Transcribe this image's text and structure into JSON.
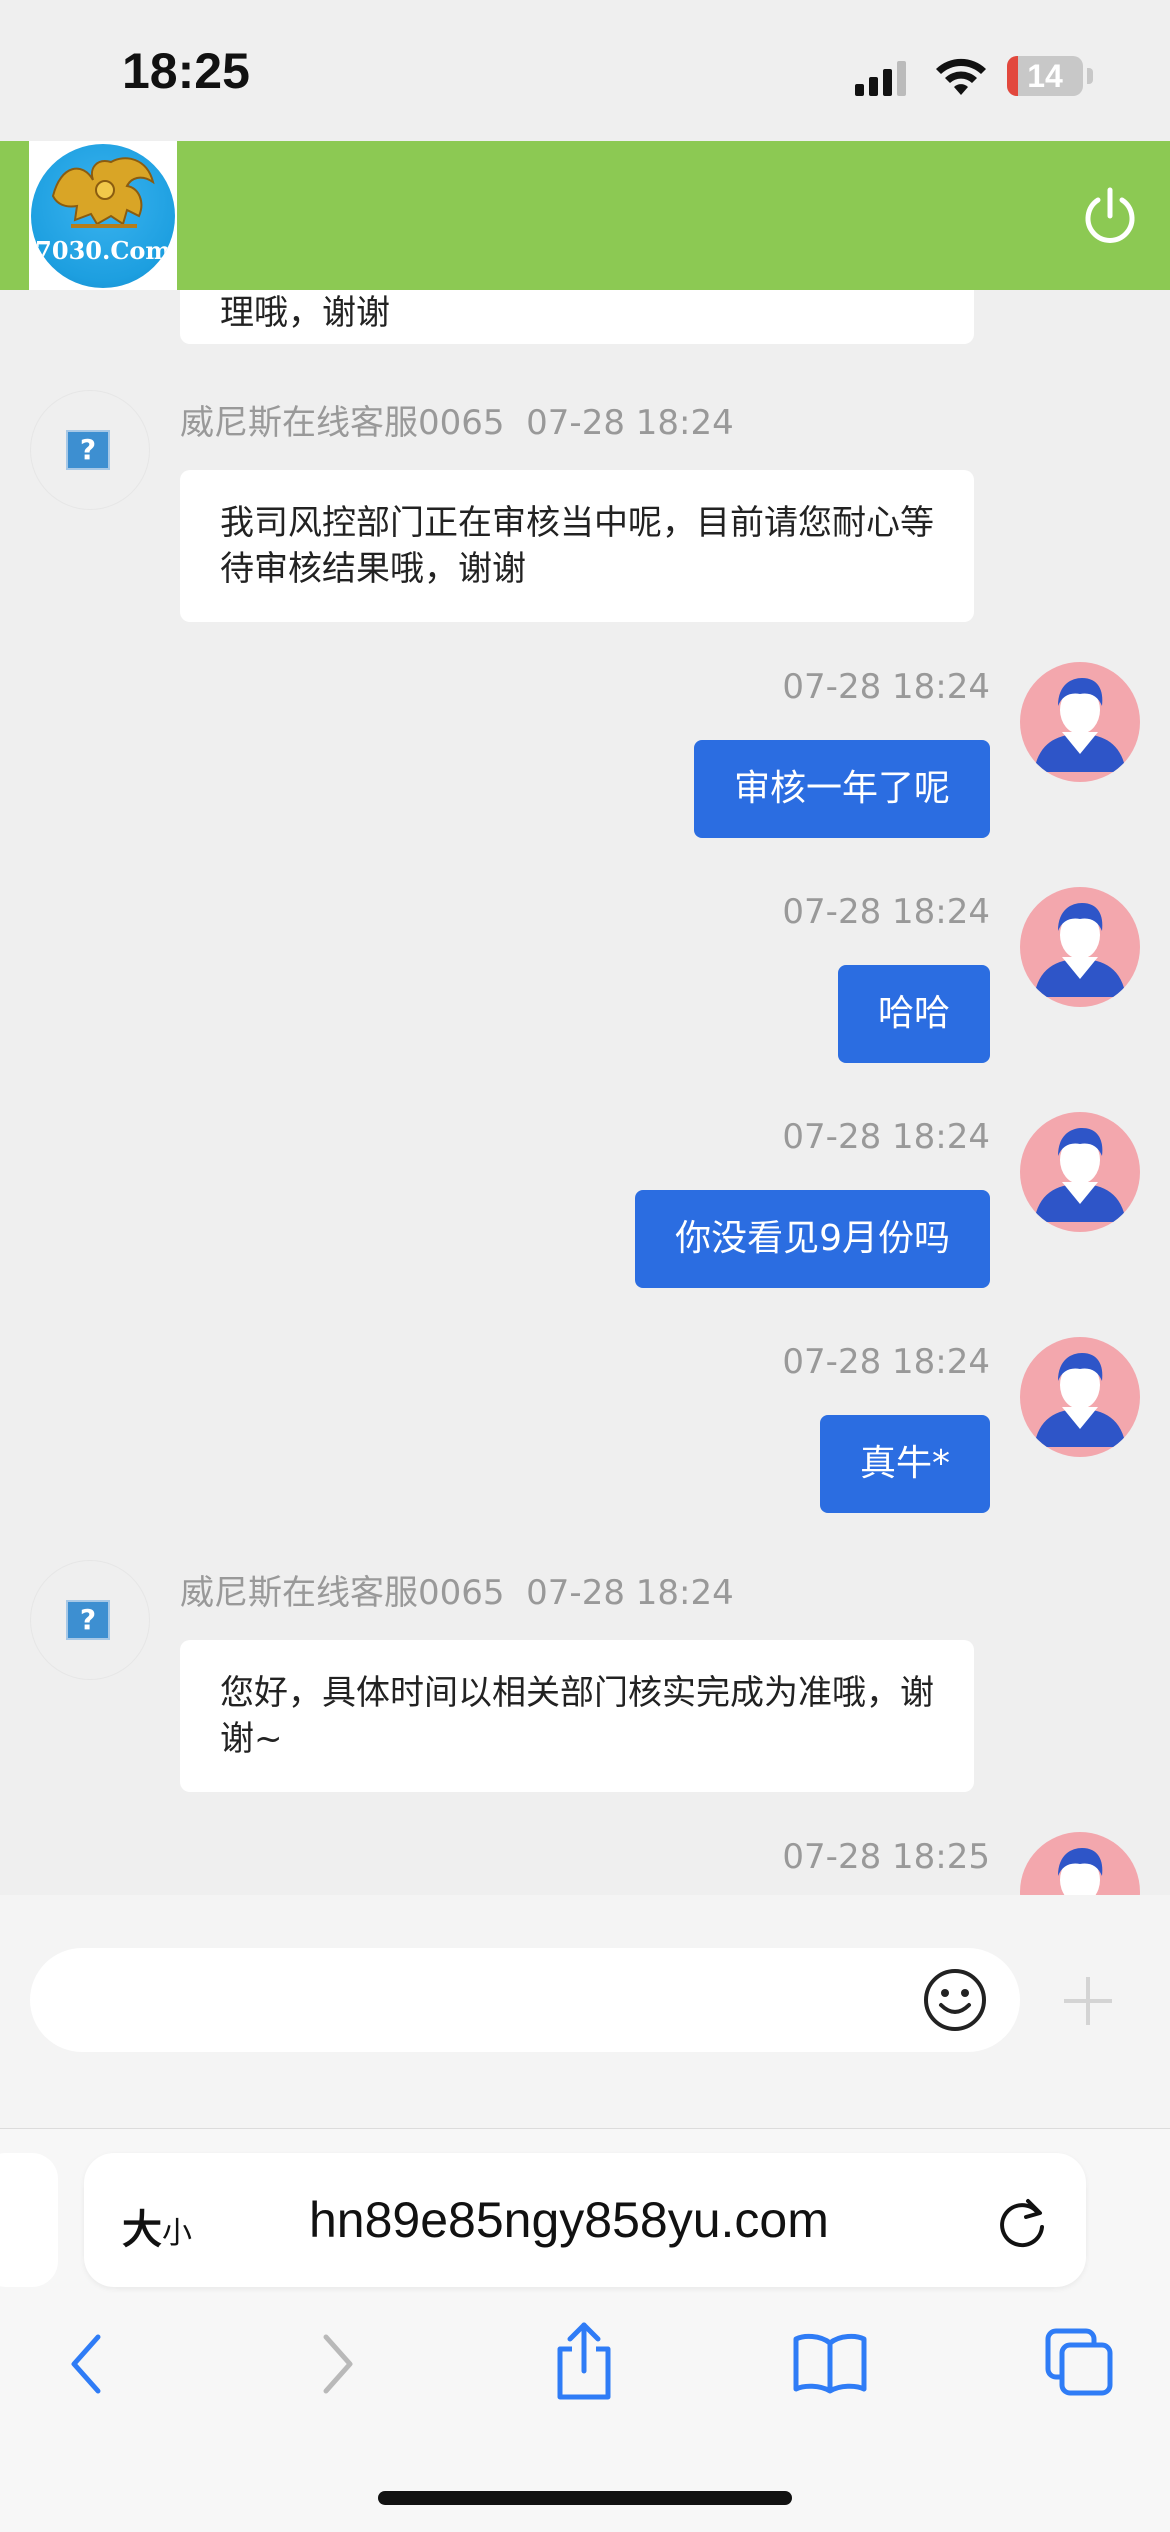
{
  "status_bar": {
    "time": "18:25",
    "battery_level": "14",
    "battery_fraction": 0.14,
    "icons": [
      "cellular-signal-icon",
      "wifi-icon",
      "battery-icon"
    ]
  },
  "header": {
    "logo_text": "7030.Com",
    "accent_color": "#8cc953",
    "power_icon": "power-icon"
  },
  "chat": {
    "partial_message": "理哦，谢谢",
    "messages": [
      {
        "sender": "agent",
        "name": "威尼斯在线客服0065",
        "time": "07-28 18:24",
        "text": "我司风控部门正在审核当中呢，目前请您耐心等待审核结果哦，谢谢"
      },
      {
        "sender": "user",
        "time": "07-28 18:24",
        "text": "审核一年了呢"
      },
      {
        "sender": "user",
        "time": "07-28 18:24",
        "text": "哈哈"
      },
      {
        "sender": "user",
        "time": "07-28 18:24",
        "text": "你没看见9月份吗"
      },
      {
        "sender": "user",
        "time": "07-28 18:24",
        "text": "真牛*"
      },
      {
        "sender": "agent",
        "name": "威尼斯在线客服0065",
        "time": "07-28 18:24",
        "text": "您好，具体时间以相关部门核实完成为准哦，谢谢~"
      },
      {
        "sender": "user",
        "time": "07-28 18:25",
        "text": ""
      }
    ],
    "user_bubble_color": "#2b6de1"
  },
  "input": {
    "placeholder": "",
    "value": "",
    "emoji_icon": "emoji-icon",
    "plus_icon": "plus-icon"
  },
  "browser": {
    "text_size_big": "大",
    "text_size_small": "小",
    "url": "hn89e85ngy858yu.com",
    "reload_icon": "reload-icon",
    "nav_icons": [
      "back-icon",
      "forward-icon",
      "share-icon",
      "bookmarks-icon",
      "tabs-icon"
    ]
  }
}
